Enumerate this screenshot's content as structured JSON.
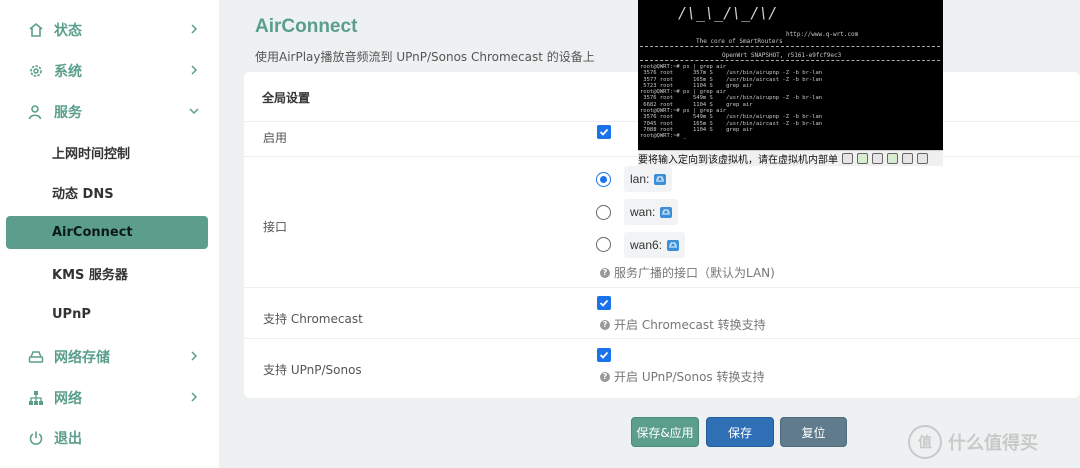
{
  "sidebar": {
    "items": [
      {
        "label": "状态",
        "icon": "home-icon"
      },
      {
        "label": "系统",
        "icon": "gear-icon"
      },
      {
        "label": "服务",
        "icon": "user-icon"
      },
      {
        "label": "网络存储",
        "icon": "storage-icon"
      },
      {
        "label": "网络",
        "icon": "network-icon"
      },
      {
        "label": "退出",
        "icon": "power-icon"
      }
    ],
    "sub_items": [
      {
        "label": "上网时间控制"
      },
      {
        "label": "动态 DNS"
      },
      {
        "label": "AirConnect",
        "active": true
      },
      {
        "label": "KMS 服务器"
      },
      {
        "label": "UPnP"
      }
    ]
  },
  "page": {
    "title": "AirConnect",
    "description": "使用AirPlay播放音频流到 UPnP/Sonos Chromecast 的设备上"
  },
  "settings": {
    "section_title": "全局设置",
    "enable_label": "启用",
    "interface_label": "接口",
    "interfaces": [
      {
        "name": "lan:",
        "selected": true
      },
      {
        "name": "wan:",
        "selected": false
      },
      {
        "name": "wan6:",
        "selected": false
      }
    ],
    "interface_hint": "服务广播的接口（默认为LAN)",
    "chromecast_label": "支持 Chromecast",
    "chromecast_hint": "开启 Chromecast 转换支持",
    "upnp_label": "支持 UPnP/Sonos",
    "upnp_hint": "开启 UPnP/Sonos 转换支持",
    "enabled": true,
    "chromecast_enabled": true,
    "upnp_enabled": true
  },
  "buttons": {
    "save_apply": "保存&应用",
    "save": "保存",
    "reset": "复位"
  },
  "colors": {
    "accent": "#5a9e8b",
    "primary_button": "#2f6fb5",
    "reset_button": "#5f7b8c"
  },
  "terminal": {
    "url": "http://www.q-wrt.com",
    "core": "The core of SmartRouters",
    "version": "OpenWrt SNAPSHOT, r5161-e9fcf9ec3",
    "lines": "root@QWRT:~# ps | grep air\n 3576 root      357m S    /usr/bin/airupnp -Z -b br-lan\n 3577 root      165m S    /usr/bin/aircast -Z -b br-lan\n 5723 root      1104 S    grep air\nroot@QWRT:~# ps | grep air\n 3576 root      549m S    /usr/bin/airupnp -Z -b br-lan\n 6682 root      1104 S    grep air\nroot@QWRT:~# ps | grep air\n 3576 root      549m S    /usr/bin/airupnp -Z -b br-lan\n 7045 root      165m S    /usr/bin/aircast -Z -b br-lan\n 7088 root      1104 S    grep air\nroot@QWRT:~# _",
    "status_bar": "要将输入定向到该虚拟机，请在虚拟机内部单"
  },
  "watermark": "什么值得买"
}
